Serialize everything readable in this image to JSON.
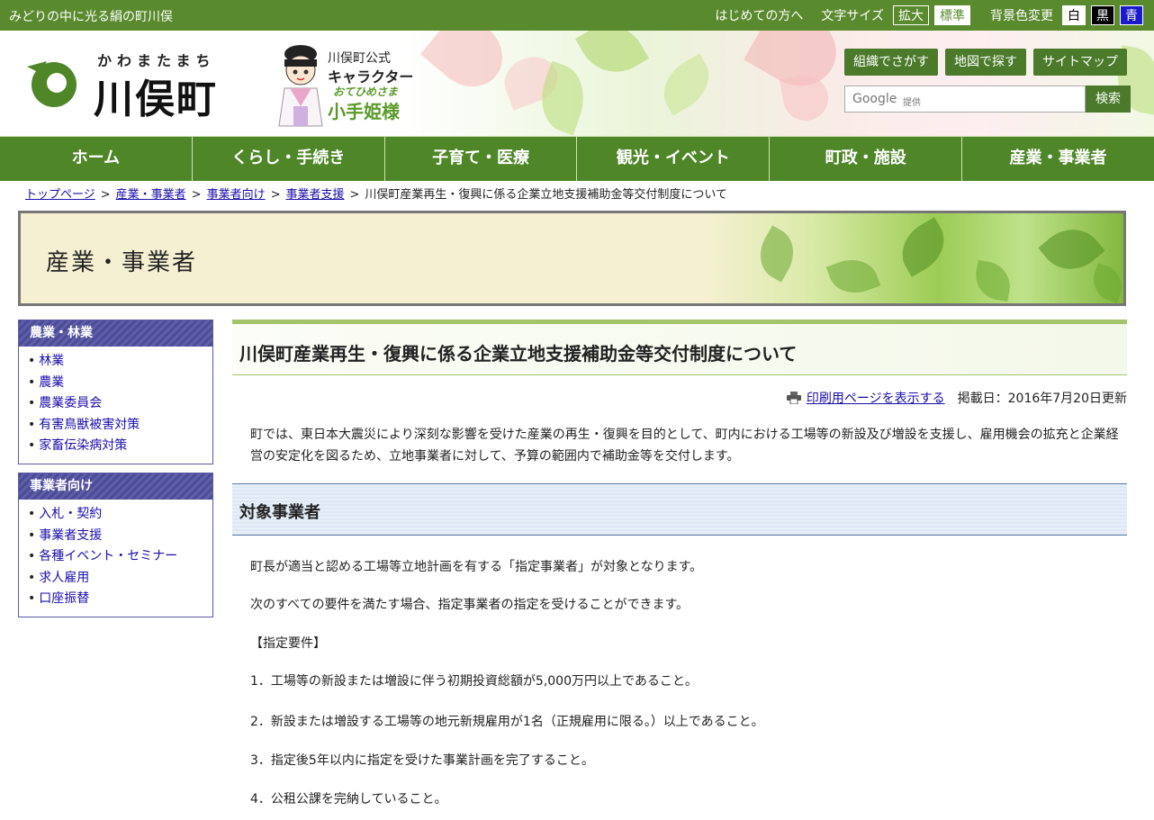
{
  "topbar": {
    "tagline": "みどりの中に光る絹の町川俣",
    "first_visit": "はじめての方へ",
    "font_size_label": "文字サイズ",
    "font_large": "拡大",
    "font_normal": "標準",
    "bg_label": "背景色変更",
    "bg_white": "白",
    "bg_black": "黒",
    "bg_blue": "青"
  },
  "header": {
    "logo_kana": "かわまたまち",
    "logo_name": "川俣町",
    "character_line1": "川俣町公式",
    "character_line2": "キャラクター",
    "character_reading": "おてひめさま",
    "character_name": "小手姫様",
    "btn_org": "組織でさがす",
    "btn_map": "地図で探す",
    "btn_sitemap": "サイトマップ",
    "search_brand": "Google",
    "search_provided": "提供",
    "search_button": "検索"
  },
  "nav": [
    "ホーム",
    "くらし・手続き",
    "子育て・医療",
    "観光・イベント",
    "町政・施設",
    "産業・事業者"
  ],
  "breadcrumb": {
    "links": [
      "トップページ",
      "産業・事業者",
      "事業者向け",
      "事業者支援"
    ],
    "separator": ">",
    "current": "川俣町産業再生・復興に係る企業立地支援補助金等交付制度について"
  },
  "banner": {
    "title": "産業・事業者"
  },
  "sidebar": [
    {
      "heading": "農業・林業",
      "items": [
        "林業",
        "農業",
        "農業委員会",
        "有害鳥獣被害対策",
        "家畜伝染病対策"
      ]
    },
    {
      "heading": "事業者向け",
      "items": [
        "入札・契約",
        "事業者支援",
        "各種イベント・セミナー",
        "求人雇用",
        "口座振替"
      ]
    }
  ],
  "article": {
    "title": "川俣町産業再生・復興に係る企業立地支援補助金等交付制度について",
    "print_link": "印刷用ページを表示する",
    "posted": "掲載日：2016年7月20日更新",
    "intro": "町では、東日本大震災により深刻な影響を受けた産業の再生・復興を目的として、町内における工場等の新設及び増設を支援し、雇用機会の拡充と企業経営の安定化を図るため、立地事業者に対して、予算の範囲内で補助金等を交付します。",
    "section1_title": "対象事業者",
    "paragraphs": [
      "町長が適当と認める工場等立地計画を有する「指定事業者」が対象となります。",
      "次のすべての要件を満たす場合、指定事業者の指定を受けることができます。",
      "【指定要件】",
      "1．工場等の新設または増設に伴う初期投資総額が5,000万円以上であること。",
      "2．新設または増設する工場等の地元新規雇用が1名（正規雇用に限る。）以上であること。",
      "3．指定後5年以内に指定を受けた事業計画を完了すること。",
      "4．公租公課を完納していること。"
    ]
  },
  "colors": {
    "brand_green": "#4e8628",
    "topbar_green": "#5a8a2e",
    "side_purple": "#5a5aa8",
    "link_blue": "#1a0dab"
  }
}
